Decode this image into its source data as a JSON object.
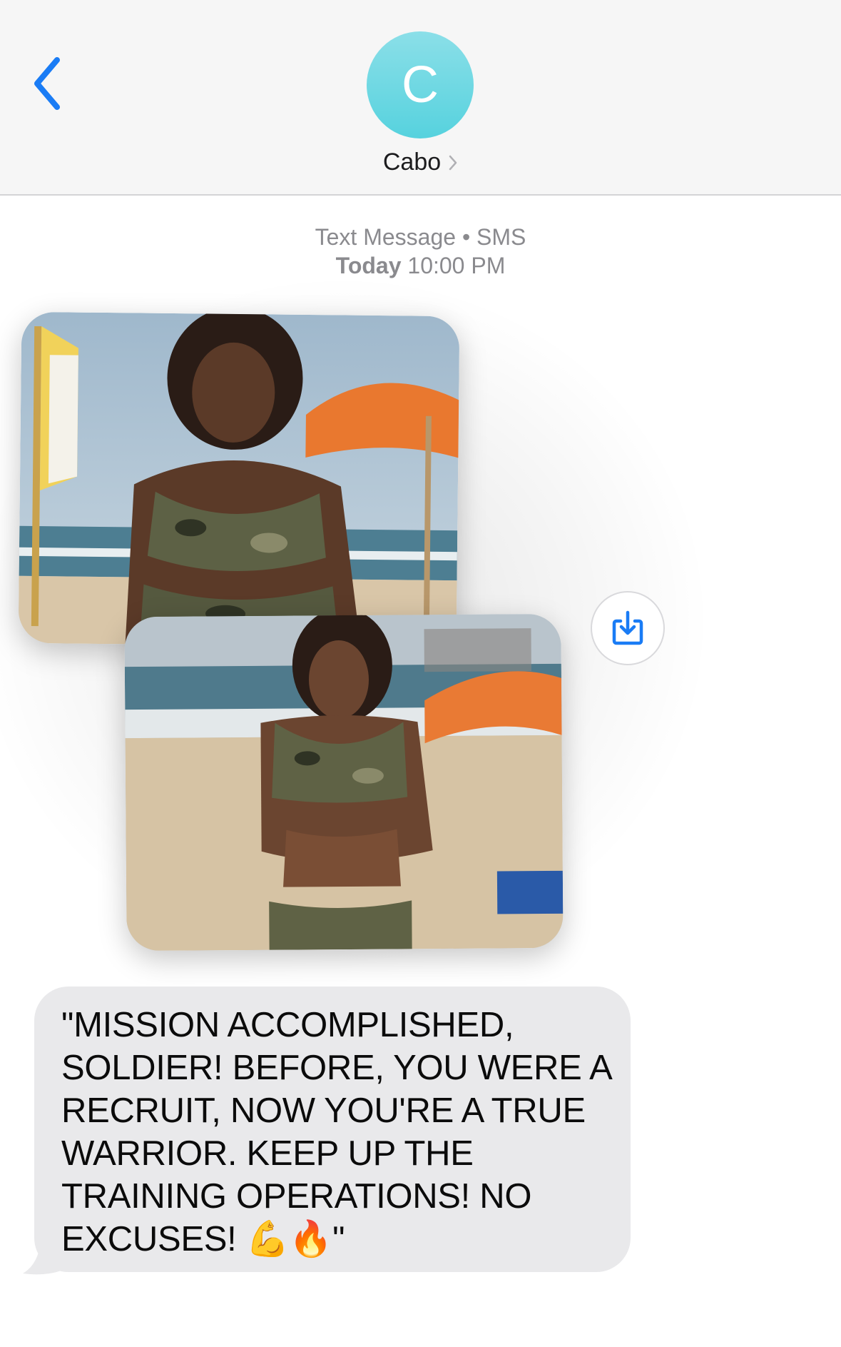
{
  "header": {
    "avatar_initial": "C",
    "contact_name": "Cabo",
    "back_icon": "chevron-left-icon",
    "accent_color": "#1a7cf5"
  },
  "thread": {
    "service_label": "Text Message • SMS",
    "day_label": "Today",
    "time_label": "10:00 PM"
  },
  "attachments": {
    "images": [
      {
        "description_icon": "photo-before"
      },
      {
        "description_icon": "photo-after"
      }
    ],
    "save_icon": "save-download-icon"
  },
  "message": {
    "text": "\"MISSION ACCOMPLISHED, SOLDIER! BEFORE, YOU WERE A RECRUIT, NOW YOU'RE A TRUE WARRIOR. KEEP UP THE TRAINING OPERATIONS! NO EXCUSES! 💪🔥\""
  }
}
